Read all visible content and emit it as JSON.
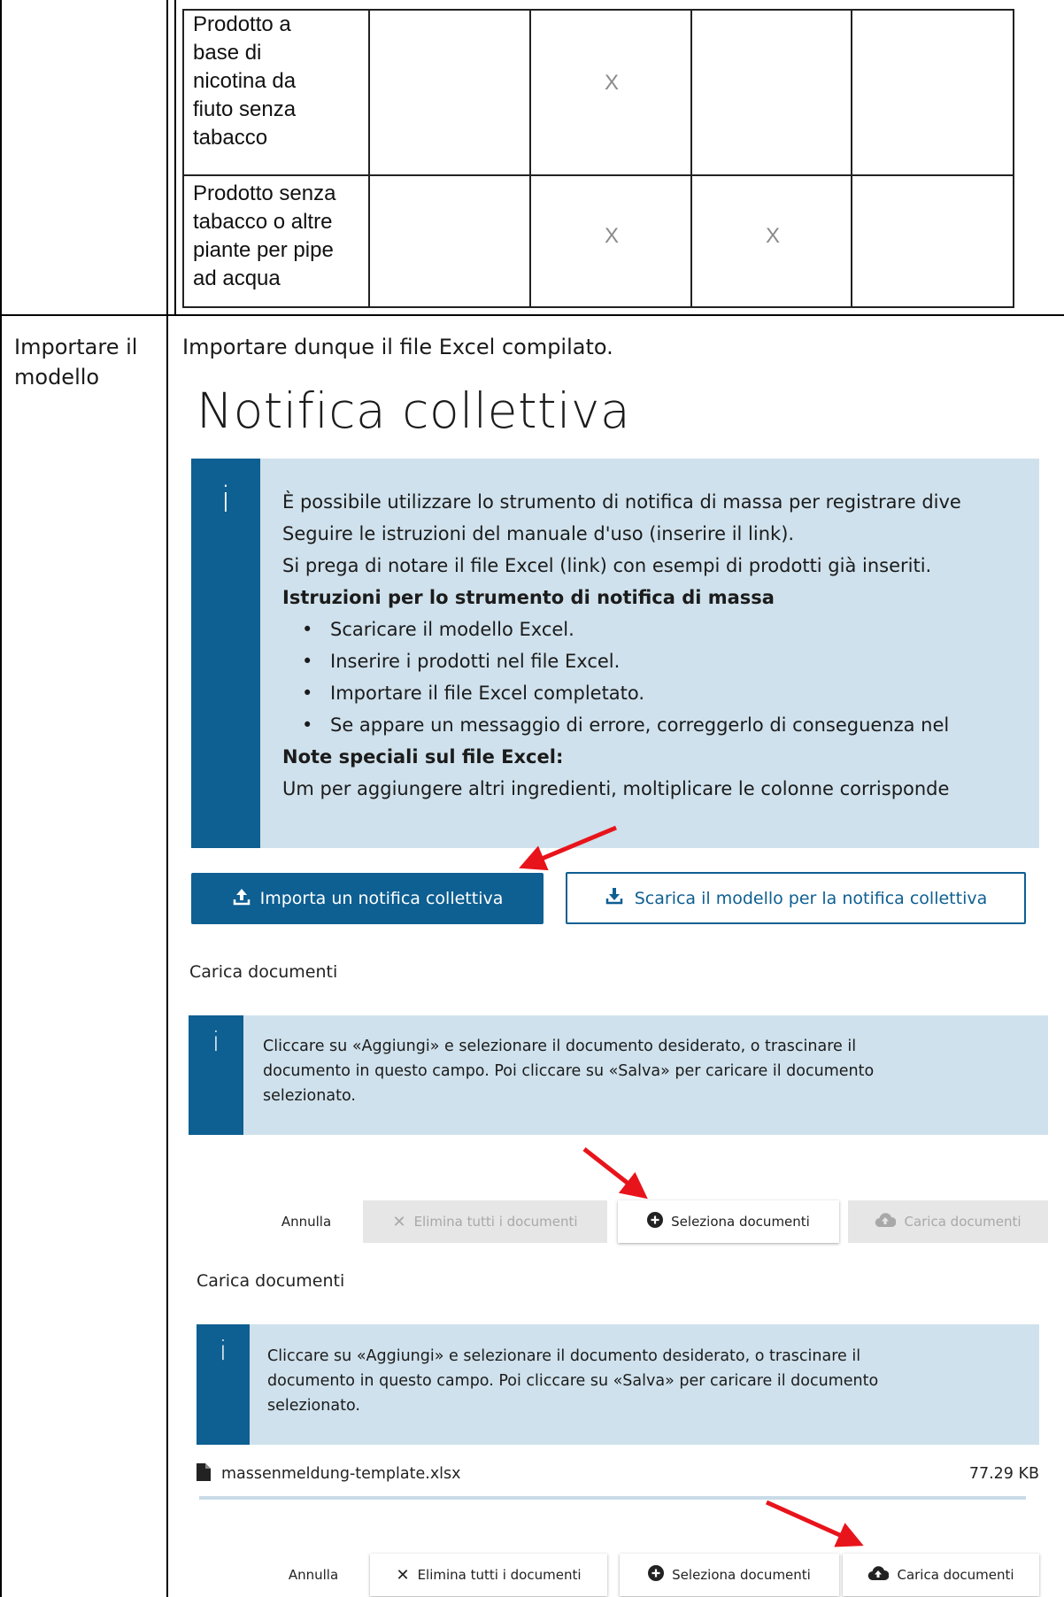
{
  "products": [
    {
      "name": "Prodotto a base di nicotina da fiuto senza tabacco",
      "lines": [
        "Prodotto a",
        "base di",
        "nicotina da",
        "fiuto senza",
        "tabacco"
      ],
      "col3": "X",
      "col4": ""
    },
    {
      "name": "Prodotto senza tabacco o altre piante per pipe ad acqua",
      "lines": [
        "Prodotto senza",
        "tabacco o altre",
        "piante per pipe",
        "ad acqua"
      ],
      "col3": "X",
      "col4": "X"
    }
  ],
  "step": {
    "label_lines": [
      "Importare il",
      "modello"
    ],
    "description": "Importare dunque il file Excel compilato."
  },
  "screenshot": {
    "title": "Notifica collettiva",
    "info_icon": "i",
    "info_lines": [
      "È possibile utilizzare lo strumento di notifica di massa per registrare dive",
      "Seguire le istruzioni del manuale d'uso (inserire il link).",
      "Si prega di notare il file Excel (link) con esempi di prodotti già inseriti."
    ],
    "instructions_heading": "Istruzioni per lo strumento di notifica di massa",
    "bullets": [
      "Scaricare il modello Excel.",
      "Inserire i prodotti nel file Excel.",
      "Importare il file Excel completato.",
      "Se appare un messaggio di errore, correggerlo di conseguenza nel"
    ],
    "notes_heading": "Note speciali sul file Excel:",
    "notes_text": "Um per aggiungere altri ingredienti, moltiplicare le colonne corrisponde",
    "import_button": "Importa un notifica collettiva",
    "download_button": "Scarica il modello per la notifica collettiva",
    "upload_sections": [
      {
        "label": "Carica documenti",
        "info": "Cliccare su «Aggiungi» e selezionare il documento desiderato, o trascinare il documento in questo campo. Poi cliccare su «Salva» per caricare il documento selezionato.",
        "info_lines": [
          "Cliccare su «Aggiungi» e selezionare il documento desiderato, o trascinare il",
          "documento in questo campo. Poi cliccare su «Salva» per caricare il documento",
          "selezionato."
        ],
        "cancel": "Annulla",
        "delete_all": "Elimina tutti i documenti",
        "select": "Seleziona documenti",
        "upload": "Carica documenti"
      },
      {
        "label": "Carica documenti",
        "info_lines": [
          "Cliccare su «Aggiungi» e selezionare il documento desiderato, o trascinare il",
          "documento in questo campo. Poi cliccare su «Salva» per caricare il documento",
          "selezionato."
        ],
        "file_name": "massenmeldung-template.xlsx",
        "file_size": "77.29 KB",
        "upload_progress": 1.0,
        "cancel": "Annulla",
        "delete_all": "Elimina tutti i documenti",
        "select": "Seleziona documenti",
        "upload": "Carica documenti"
      }
    ]
  },
  "colors": {
    "primary": "#0e5f92",
    "info_background": "#cfe1ec",
    "annotation_arrow": "#e8141b"
  }
}
